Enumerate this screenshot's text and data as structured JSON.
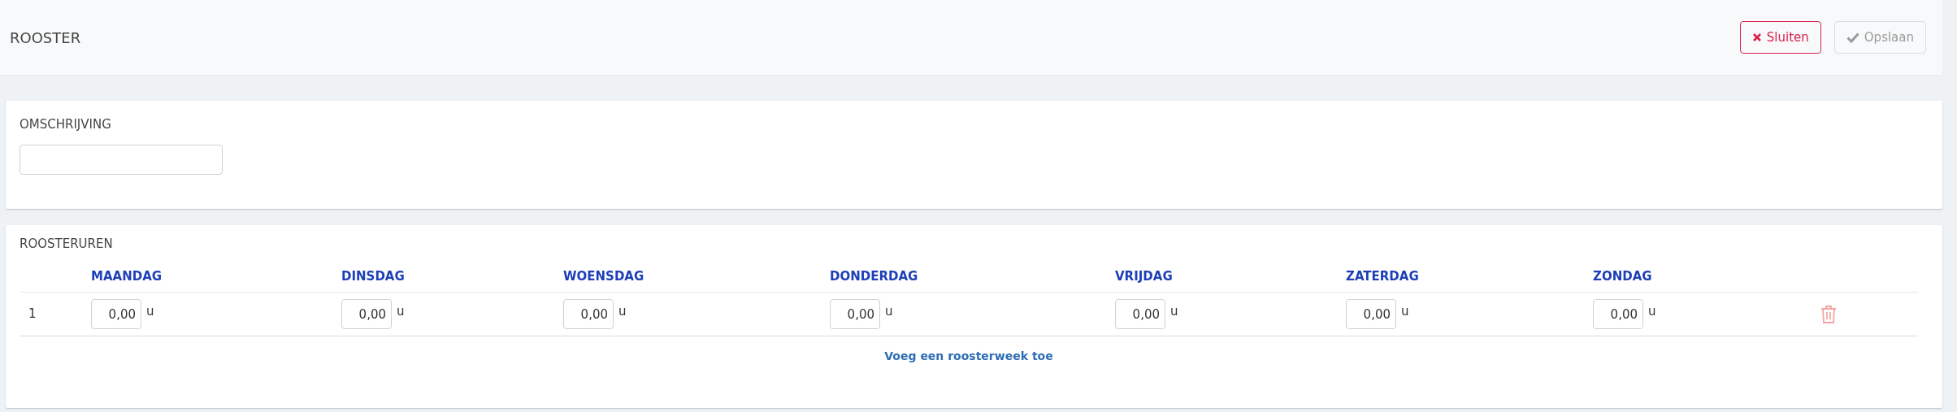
{
  "header": {
    "title": "ROOSTER",
    "buttons": [
      {
        "kind": "close",
        "label": "Sluiten",
        "disabled": false
      },
      {
        "kind": "save",
        "label": "Opslaan",
        "disabled": true
      }
    ]
  },
  "description": {
    "label": "OMSCHRIJVING"
  },
  "schedule": {
    "title": "ROOSTERUREN",
    "columns": [
      "MAANDAG",
      "DINSDAG",
      "WOENSDAG",
      "DONDERDAG",
      "VRIJDAG",
      "ZATERDAG",
      "ZONDAG"
    ],
    "rows": [
      {
        "number": "1",
        "hours": [
          {
            "value": "0,00",
            "unit": "u"
          },
          {
            "value": "0,00",
            "unit": "u"
          },
          {
            "value": "0,00",
            "unit": "u"
          },
          {
            "value": "0,00",
            "unit": "u"
          },
          {
            "value": "0,00",
            "unit": "u"
          },
          {
            "value": "0,00",
            "unit": "u"
          },
          {
            "value": "0,00",
            "unit": "u"
          }
        ]
      }
    ],
    "add_link": "Voeg een roosterweek toe"
  }
}
